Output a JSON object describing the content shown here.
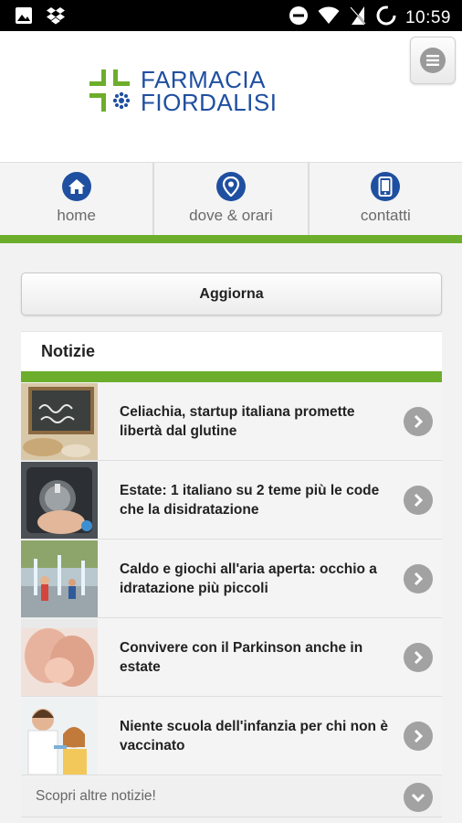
{
  "status_bar": {
    "time": "10:59",
    "left_icons": [
      "image-icon",
      "dropbox-icon"
    ],
    "right_icons": [
      "do-not-disturb-icon",
      "wifi-icon",
      "no-sim-icon",
      "battery-icon"
    ]
  },
  "header": {
    "logo_line1": "FARMACIA",
    "logo_line2": "FIORDALISI",
    "menu_icon": "hamburger-menu-icon"
  },
  "nav": {
    "items": [
      {
        "label": "home",
        "icon": "home-icon"
      },
      {
        "label": "dove & orari",
        "icon": "location-pin-icon"
      },
      {
        "label": "contatti",
        "icon": "phone-icon"
      }
    ]
  },
  "update_button": "Aggiorna",
  "news": {
    "title": "Notizie",
    "items": [
      {
        "title": "Celiachia, startup italiana promette libertà dal glutine"
      },
      {
        "title": "Estate: 1 italiano su 2 teme più le code che la disidratazione"
      },
      {
        "title": "Caldo e giochi all'aria aperta: occhio a idratazione più piccoli"
      },
      {
        "title": "Convivere con il Parkinson anche in estate"
      },
      {
        "title": "Niente scuola dell'infanzia per chi non è vaccinato"
      }
    ],
    "more_label": "Scopri altre notizie!"
  },
  "colors": {
    "brand_blue": "#1f4fa0",
    "brand_green": "#6cae2c",
    "arrow_gray": "#a2a2a2"
  }
}
